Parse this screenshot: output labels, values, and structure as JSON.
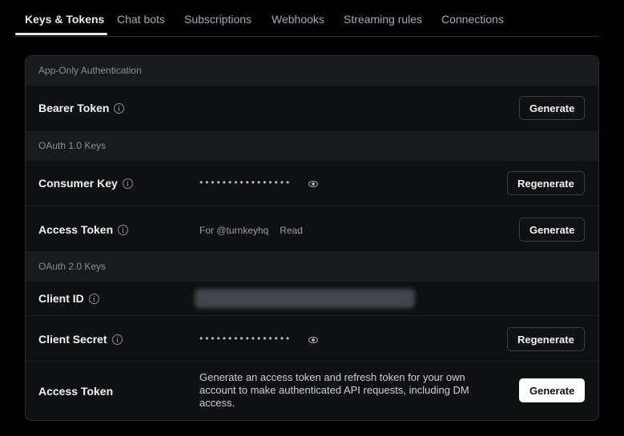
{
  "tabs": [
    {
      "label": "Keys & Tokens"
    },
    {
      "label": "Chat bots"
    },
    {
      "label": "Subscriptions"
    },
    {
      "label": "Webhooks"
    },
    {
      "label": "Streaming rules"
    },
    {
      "label": "Connections"
    }
  ],
  "sections": {
    "app_only": "App-Only Authentication",
    "oauth1": "OAuth 1.0 Keys",
    "oauth2": "OAuth 2.0 Keys"
  },
  "rows": {
    "bearer": {
      "label": "Bearer Token",
      "button": "Generate"
    },
    "consumer": {
      "label": "Consumer Key",
      "mask": "••••••••••••••••",
      "button": "Regenerate"
    },
    "access1": {
      "label": "Access Token",
      "for": "For @turnkeyhq",
      "perm": "Read",
      "button": "Generate"
    },
    "client_id": {
      "label": "Client ID"
    },
    "client_secret": {
      "label": "Client Secret",
      "mask": "••••••••••••••••",
      "button": "Regenerate"
    },
    "access2": {
      "label": "Access Token",
      "description": "Generate an access token and refresh token for your own account to make authenticated API requests, including DM access.",
      "button": "Generate"
    }
  },
  "icons": {
    "info": "info-circle-icon",
    "eye": "eye-icon"
  },
  "colors": {
    "background": "#000000",
    "card": "#0f1011",
    "section_header": "#181a1c",
    "primary_button": "#ffffff"
  }
}
